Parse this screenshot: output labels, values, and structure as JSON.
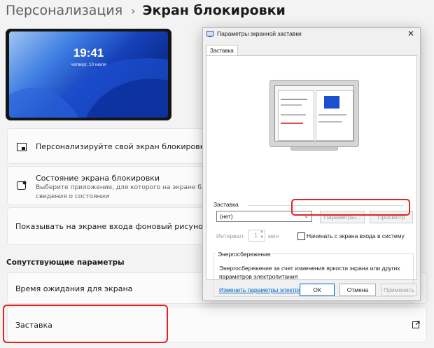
{
  "breadcrumb": {
    "parent": "Персонализация",
    "separator": "›",
    "current": "Экран блокировки"
  },
  "preview": {
    "time": "19:41",
    "date": "четверг, 10 июля"
  },
  "cards": {
    "personalize": {
      "title": "Персонализируйте свой экран блокировки",
      "icon": "lock-screen-icon"
    },
    "status": {
      "title": "Состояние экрана блокировки",
      "desc_line1": "Выберите приложение, для которого на экране блокировки",
      "desc_line2": "сведения о состоянии",
      "icon": "status-icon"
    },
    "signin_bg": {
      "title": "Показывать на экране входа фоновый рисунок экрана бло"
    }
  },
  "related": {
    "label": "Сопутствующие параметры",
    "timeout": "Время ожидания для экрана",
    "screensaver": "Заставка",
    "external_icon": "external-link-icon"
  },
  "dialog": {
    "title": "Параметры экранной заставки",
    "close": "✕",
    "tab": "Заставка",
    "group_screensaver": "Заставка",
    "dropdown_value": "(нет)",
    "btn_params": "Параметры...",
    "btn_preview": "Просмотр",
    "interval_label": "Интервал:",
    "interval_value": "1",
    "interval_unit": "мин",
    "checkbox_label": "Начинать с экрана входа в систему",
    "group_power": "Энергосбережение",
    "power_text_line1": "Энергосбережение за счет изменения яркости экрана или других",
    "power_text_line2": "параметров электропитания",
    "power_link": "Изменить параметры электропитания",
    "btn_ok": "ОК",
    "btn_cancel": "Отмена",
    "btn_apply": "Применить"
  },
  "colors": {
    "highlight": "#e02424",
    "link": "#0066cc",
    "accent": "#0067c0"
  }
}
